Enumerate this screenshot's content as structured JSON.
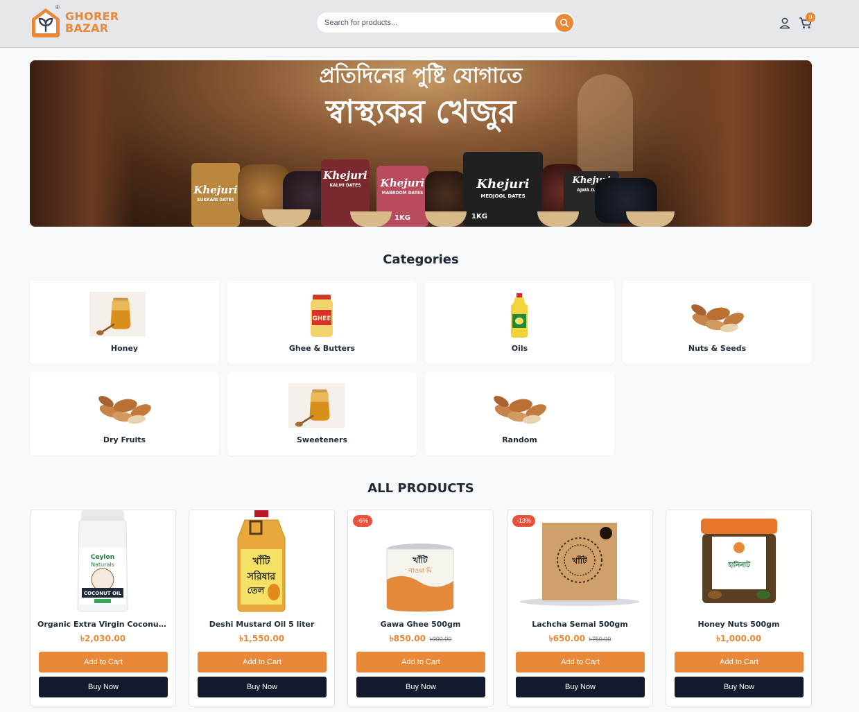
{
  "header": {
    "logo_line1": "GHORER",
    "logo_line2": "BAZAR",
    "logo_reg": "®",
    "search_placeholder": "Search for products...",
    "cart_count": "0",
    "icons": [
      "search-icon",
      "user-icon",
      "cart-icon"
    ],
    "accent": "#e8893a"
  },
  "banner": {
    "line1": "প্রতিদিনের পুষ্টি যোগাতে",
    "line2": "স্বাস্থ্যকর খেজুর",
    "brand": "Khejuri",
    "products": [
      "SUKKARI DATES",
      "KALMI DATES",
      "MABROOM DATES",
      "MEDJOOL DATES",
      "AJWA DATES"
    ],
    "weights": [
      "1KG",
      "1KG"
    ]
  },
  "categories": {
    "title": "Categories",
    "items": [
      {
        "label": "Honey"
      },
      {
        "label": "Ghee & Butters"
      },
      {
        "label": "Oils"
      },
      {
        "label": "Nuts & Seeds"
      },
      {
        "label": "Dry Fruits"
      },
      {
        "label": "Sweeteners"
      },
      {
        "label": "Random"
      }
    ]
  },
  "products": {
    "title": "ALL PRODUCTS",
    "add_to_cart": "Add to Cart",
    "buy_now": "Buy Now",
    "items": [
      {
        "name": "Organic Extra Virgin Coconut Oil ...",
        "price": "৳2,030.00",
        "old_price": "",
        "badge": ""
      },
      {
        "name": "Deshi Mustard Oil 5 liter",
        "price": "৳1,550.00",
        "old_price": "",
        "badge": ""
      },
      {
        "name": "Gawa Ghee 500gm",
        "price": "৳850.00",
        "old_price": "৳900.00",
        "badge": "-6%"
      },
      {
        "name": "Lachcha Semai 500gm",
        "price": "৳650.00",
        "old_price": "৳750.00",
        "badge": "-13%"
      },
      {
        "name": "Honey Nuts 500gm",
        "price": "৳1,000.00",
        "old_price": "",
        "badge": ""
      }
    ]
  }
}
